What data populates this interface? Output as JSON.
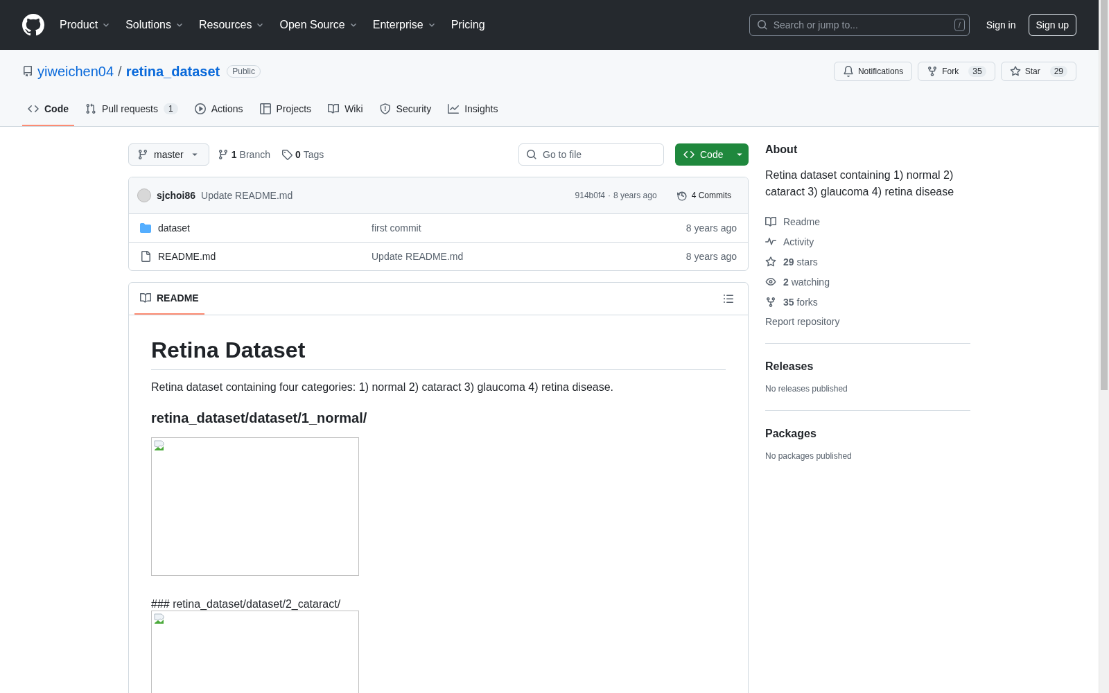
{
  "top_nav": {
    "menu": [
      {
        "label": "Product",
        "has_menu": true
      },
      {
        "label": "Solutions",
        "has_menu": true
      },
      {
        "label": "Resources",
        "has_menu": true
      },
      {
        "label": "Open Source",
        "has_menu": true
      },
      {
        "label": "Enterprise",
        "has_menu": true
      },
      {
        "label": "Pricing",
        "has_menu": false
      }
    ],
    "search": {
      "placeholder": "Search or jump to...",
      "shortcut": "/"
    },
    "sign_in": "Sign in",
    "sign_up": "Sign up"
  },
  "repo": {
    "owner": "yiweichen04",
    "separator": "/",
    "name": "retina_dataset",
    "visibility": "Public",
    "actions": [
      {
        "kind": "notifications",
        "label": "Notifications"
      },
      {
        "kind": "fork",
        "label": "Fork",
        "count": "35"
      },
      {
        "kind": "star",
        "label": "Star",
        "count": "29"
      }
    ]
  },
  "tabs": [
    {
      "kind": "code",
      "label": "Code",
      "selected": true
    },
    {
      "kind": "pulls",
      "label": "Pull requests",
      "count": "1",
      "selected": false
    },
    {
      "kind": "actions",
      "label": "Actions",
      "selected": false
    },
    {
      "kind": "projects",
      "label": "Projects",
      "selected": false
    },
    {
      "kind": "wiki",
      "label": "Wiki",
      "selected": false
    },
    {
      "kind": "security",
      "label": "Security",
      "selected": false
    },
    {
      "kind": "insights",
      "label": "Insights",
      "selected": false
    }
  ],
  "branch": "master",
  "branches": {
    "count": "1",
    "label": "Branch"
  },
  "tags": {
    "count": "0",
    "label": "Tags"
  },
  "file_search": {
    "placeholder": "Go to file"
  },
  "code_button": "Code",
  "latest_commit": {
    "author": "sjchoi86",
    "message": "Update README.md",
    "hash": "914b0f4",
    "separator": "·",
    "age": "8 years ago",
    "commits": "4 Commits"
  },
  "files": [
    {
      "kind": "folder",
      "name": "dataset",
      "message": "first commit",
      "age": "8 years ago"
    },
    {
      "kind": "file",
      "name": "README.md",
      "message": "Update README.md",
      "age": "8 years ago"
    }
  ],
  "readme": {
    "tab": "README",
    "title": "Retina Dataset",
    "intro": "Retina dataset containing four categories: 1) normal 2) cataract 3) glaucoma 4) retina disease.",
    "blocks": [
      {
        "kind": "heading",
        "text": "retina_dataset/dataset/1_normal/"
      },
      {
        "kind": "image"
      },
      {
        "kind": "text",
        "text": "### retina_dataset/dataset/2_cataract/"
      },
      {
        "kind": "image"
      }
    ]
  },
  "sidebar": {
    "about_title": "About",
    "description": "Retina dataset containing 1) normal 2) cataract 3) glaucoma 4) retina disease",
    "links": [
      {
        "kind": "readme",
        "label": "Readme"
      },
      {
        "kind": "activity",
        "label": "Activity"
      },
      {
        "kind": "stars",
        "count": "29",
        "label": "stars"
      },
      {
        "kind": "watching",
        "count": "2",
        "label": "watching"
      },
      {
        "kind": "forks",
        "count": "35",
        "label": "forks"
      }
    ],
    "report": "Report repository",
    "sections": [
      {
        "title": "Releases",
        "note": "No releases published"
      },
      {
        "title": "Packages",
        "note": "No packages published"
      }
    ]
  }
}
